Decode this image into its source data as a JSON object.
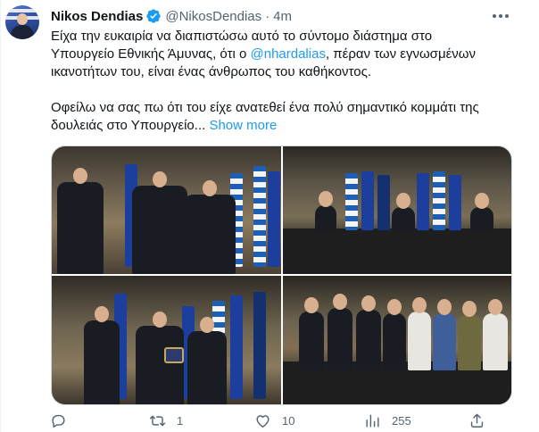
{
  "tweet": {
    "author_name": "Nikos Dendias",
    "handle": "@NikosDendias",
    "separator": "·",
    "time": "4m",
    "text": {
      "line1": "Είχα την ευκαιρία να διαπιστώσω αυτό το σύντομο διάστημα στο",
      "line2_pre": "Υπουργείο Εθνικής Άμυνας, ότι ο ",
      "line2_mention": "@nhardalias",
      "line2_post": ", πέραν των εγνωσμένων",
      "line3": "ικανοτήτων  του, είναι ένας άνθρωπος του καθήκοντος.",
      "line4": "Οφείλω να σας πω ότι του είχε ανατεθεί ένα πολύ σημαντικό κομμάτι της",
      "line5": "δουλειάς στο Υπουργείο...",
      "show_more": "Show more"
    },
    "media_count": 4,
    "counts": {
      "replies": "",
      "retweets": "1",
      "likes": "10",
      "views": "255"
    }
  },
  "icons": {
    "verified": "verified-badge-icon",
    "more": "more-dots-icon",
    "reply": "reply-icon",
    "retweet": "retweet-icon",
    "like": "heart-icon",
    "views": "views-icon",
    "share": "share-icon"
  },
  "colors": {
    "text": "#0f1419",
    "secondary": "#536471",
    "link": "#1d9bf0",
    "verified": "#1d9bf0",
    "border": "#cfd9de"
  }
}
